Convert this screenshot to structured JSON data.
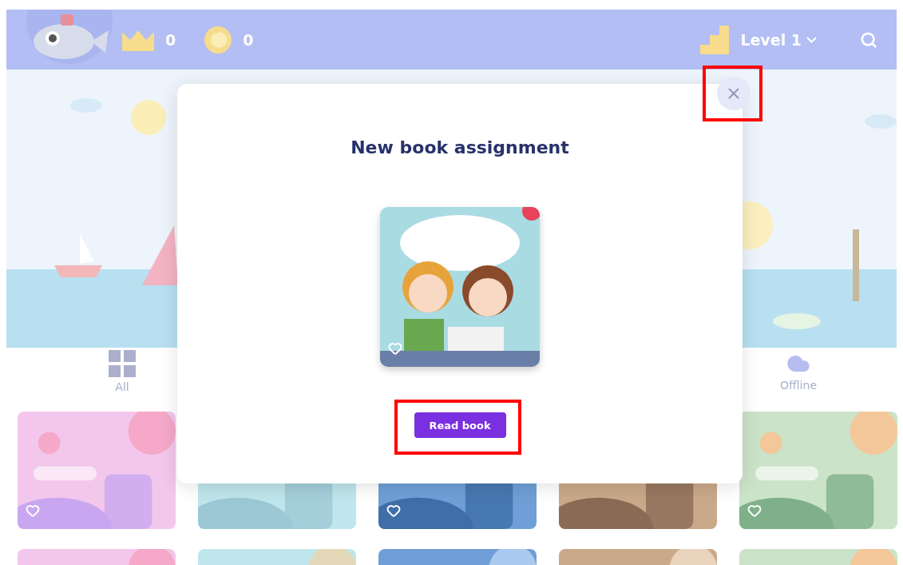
{
  "header": {
    "crowns": "0",
    "coins": "0",
    "level": "Level 1"
  },
  "tabs": [
    {
      "label": "All",
      "kind": "grid"
    },
    {
      "label": "Offline",
      "kind": "cloud"
    }
  ],
  "cards": [
    {
      "kind": "picture",
      "heart": true
    },
    {
      "kind": "picture"
    },
    {
      "kind": "picture",
      "heart": true
    },
    {
      "kind": "picture"
    },
    {
      "kind": "picture",
      "heart": true
    },
    {
      "kind": "picture"
    },
    {
      "kind": "picture"
    },
    {
      "kind": "picture"
    },
    {
      "kind": "picture"
    },
    {
      "kind": "picture"
    }
  ],
  "modal": {
    "title": "New book assignment",
    "cover": {
      "kind": "picture",
      "heart": true
    },
    "button": "Read book",
    "close_highlighted": true,
    "button_highlighted": true
  }
}
